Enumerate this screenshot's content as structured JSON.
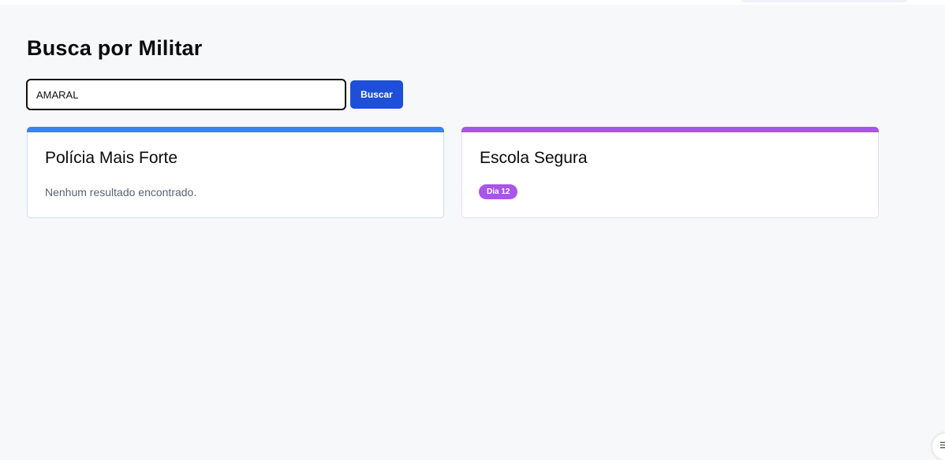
{
  "page": {
    "title": "Busca por Militar"
  },
  "search": {
    "value": "AMARAL",
    "button_label": "Buscar"
  },
  "cards": [
    {
      "title": "Polícia Mais Forte",
      "empty_message": "Nenhum resultado encontrado.",
      "accent_color": "#3b82f6",
      "border_color": "#bfdbfe"
    },
    {
      "title": "Escola Segura",
      "badge": "Dia 12",
      "accent_color": "#a855f7",
      "border_color": "#e9d5ff"
    }
  ],
  "colors": {
    "primary_button": "#1d4fd8",
    "background": "#f7f8fa"
  },
  "corner_widget": {
    "icon": "list-icon"
  }
}
